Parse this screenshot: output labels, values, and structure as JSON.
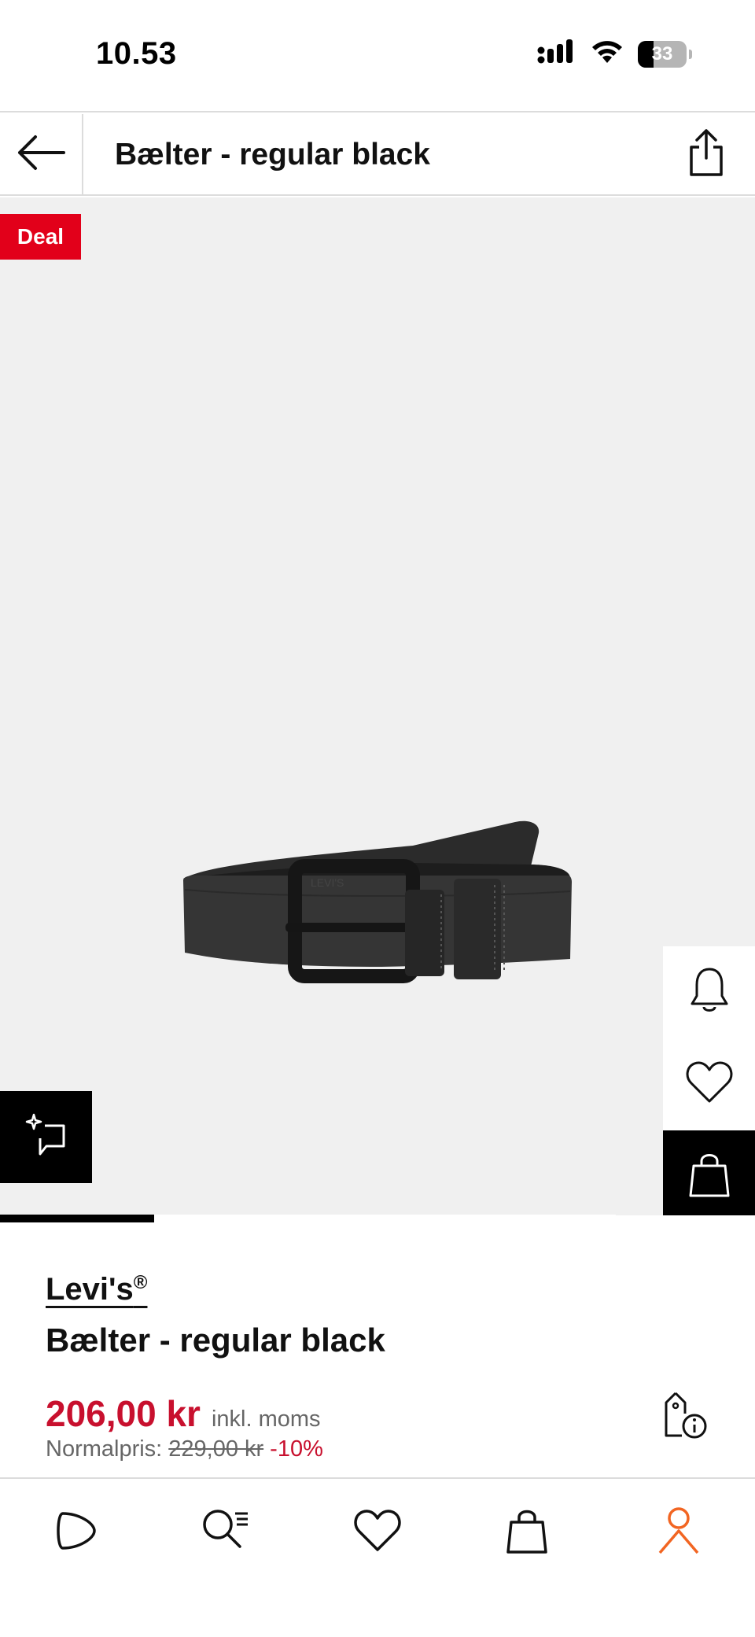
{
  "status_bar": {
    "time": "10.53",
    "battery": "33",
    "battery_level": 0.33,
    "icons": [
      "cellular-signal-icon",
      "wifi-icon",
      "battery-icon"
    ]
  },
  "header": {
    "title": "Bælter - regular black",
    "back_icon": "arrow-left-icon",
    "share_icon": "share-icon"
  },
  "gallery": {
    "badge": "Deal",
    "image_subject": "black leather belt",
    "belt_embossing": "LEVI'S",
    "gallery_position": 0.25,
    "ai_icon": "sparkle-chat-icon",
    "side_actions": [
      "bell-icon",
      "heart-icon",
      "shopping-bag-icon"
    ]
  },
  "product": {
    "brand": "Levi's",
    "brand_mark": "®",
    "name": "Bælter - regular black",
    "price": "206,00 kr",
    "vat_note": "inkl. moms",
    "normal_label": "Normalpris:",
    "normal_price": "229,00 kr",
    "discount": "-10%",
    "price_info_icon": "price-tag-info-icon"
  },
  "tabbar": {
    "tabs": [
      "home-icon",
      "search-icon",
      "wishlist-icon",
      "cart-icon",
      "profile-icon"
    ],
    "active_color": "#f26522"
  },
  "colors": {
    "accent_red": "#c8102e",
    "deal_red": "#e2001a",
    "gallery_bg": "#f0f0f0"
  }
}
